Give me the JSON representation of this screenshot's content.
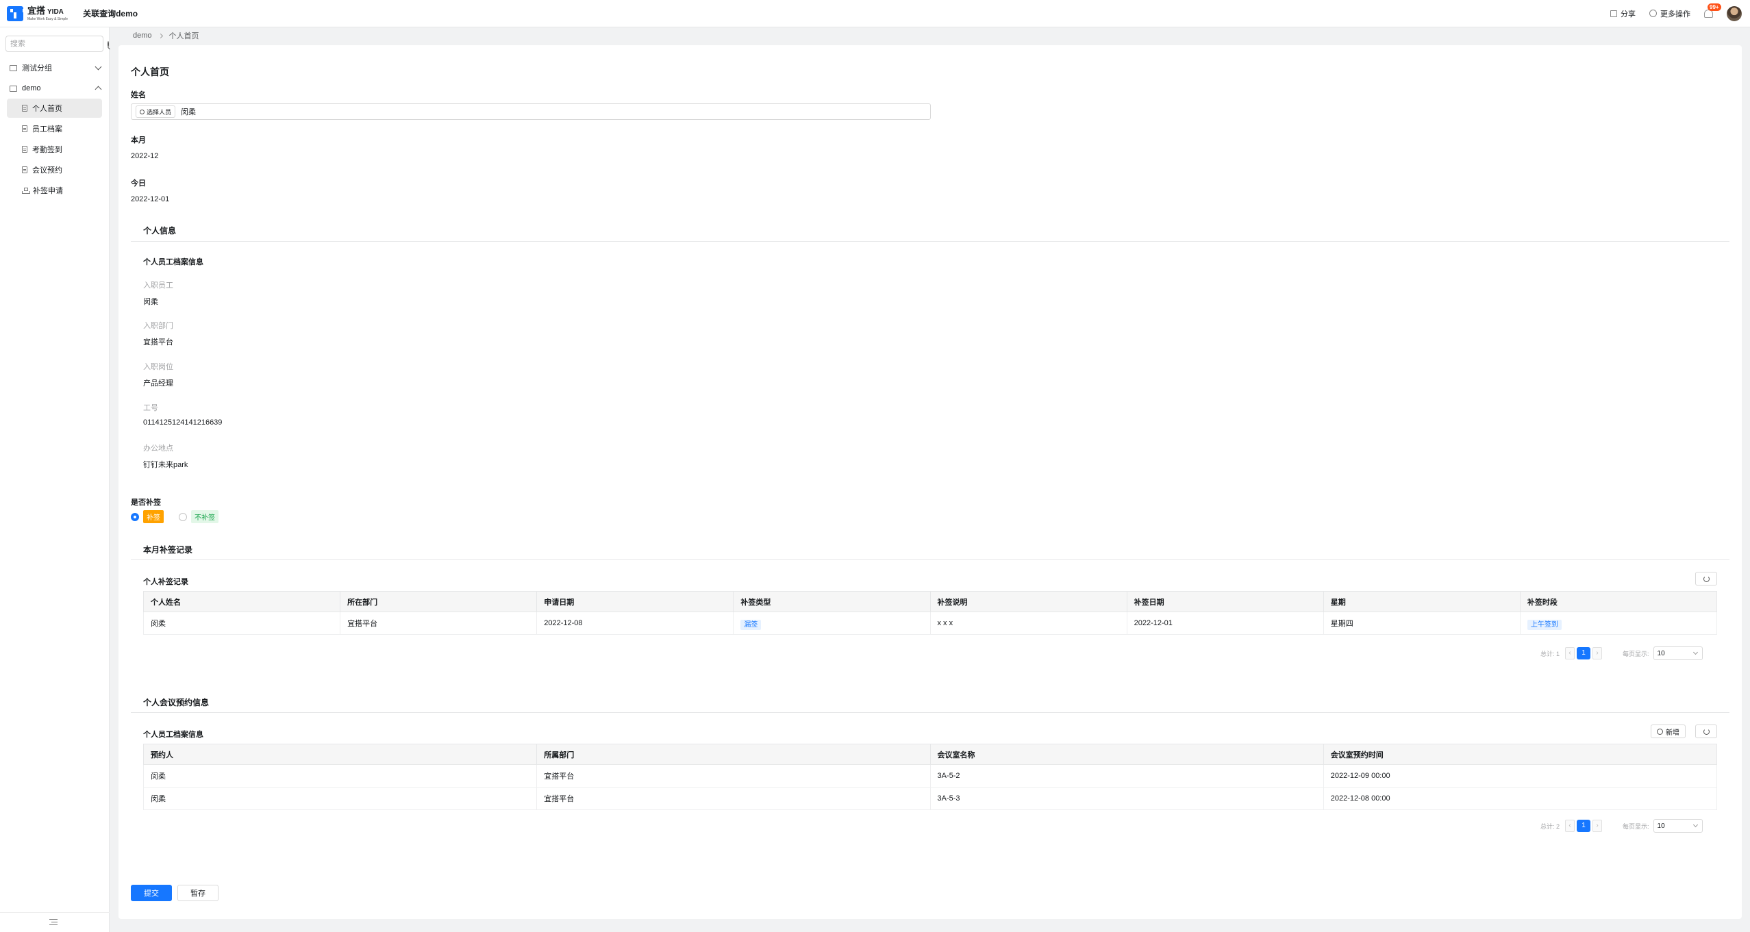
{
  "header": {
    "logo_cn": "宜搭",
    "logo_en": "YIDA",
    "logo_tagline": "Make Work Easy & Simple",
    "app_title": "关联查询demo",
    "share_label": "分享",
    "more_label": "更多操作",
    "notification_count": "99+"
  },
  "sidebar": {
    "search_placeholder": "搜索",
    "groups": [
      {
        "label": "测试分组",
        "expanded": false
      },
      {
        "label": "demo",
        "expanded": true
      }
    ],
    "items": [
      {
        "label": "个人首页",
        "active": true
      },
      {
        "label": "员工档案"
      },
      {
        "label": "考勤签到"
      },
      {
        "label": "会议预约"
      },
      {
        "label": "补签申请"
      }
    ]
  },
  "breadcrumb": [
    "demo",
    "个人首页"
  ],
  "form": {
    "page_title": "个人首页",
    "name_label": "姓名",
    "select_person_label": "选择人员",
    "name_value": "闵柔",
    "month_label": "本月",
    "month_value": "2022-12",
    "today_label": "今日",
    "today_value": "2022-12-01",
    "personal_info_title": "个人信息",
    "employee_archive_title": "个人员工档案信息",
    "fields": [
      {
        "label": "入职员工",
        "value": "闵柔"
      },
      {
        "label": "入职部门",
        "value": "宜搭平台"
      },
      {
        "label": "入职岗位",
        "value": "产品经理"
      },
      {
        "label": "工号",
        "value": "0114125124141216639"
      },
      {
        "label": "办公地点",
        "value": "钉钉未来park"
      }
    ],
    "resign_question": "是否补签",
    "resign_options": [
      {
        "label": "补签",
        "selected": true,
        "color": "#ffa200"
      },
      {
        "label": "不补签",
        "selected": false,
        "color": "#16a34a"
      }
    ],
    "month_records_title": "本月补签记录",
    "records_table": {
      "title": "个人补签记录",
      "columns": [
        "个人姓名",
        "所在部门",
        "申请日期",
        "补签类型",
        "补签说明",
        "补签日期",
        "星期",
        "补签时段"
      ],
      "rows": [
        [
          "闵柔",
          "宜搭平台",
          "2022-12-08",
          "漏签",
          "x x x",
          "2022-12-01",
          "星期四",
          "上午签到"
        ]
      ],
      "total_text": "总计: 1",
      "current_page": "1",
      "page_size_label": "每页显示:",
      "page_size": "10"
    },
    "meeting_title": "个人会议预约信息",
    "meeting_table": {
      "title": "个人员工档案信息",
      "add_label": "新增",
      "columns": [
        "预约人",
        "所属部门",
        "会议室名称",
        "会议室预约时间"
      ],
      "rows": [
        [
          "闵柔",
          "宜搭平台",
          "3A-5-2",
          "2022-12-09 00:00"
        ],
        [
          "闵柔",
          "宜搭平台",
          "3A-5-3",
          "2022-12-08 00:00"
        ]
      ],
      "total_text": "总计: 2",
      "current_page": "1",
      "page_size_label": "每页显示:",
      "page_size": "10"
    },
    "submit_label": "提交",
    "draft_label": "暂存"
  }
}
